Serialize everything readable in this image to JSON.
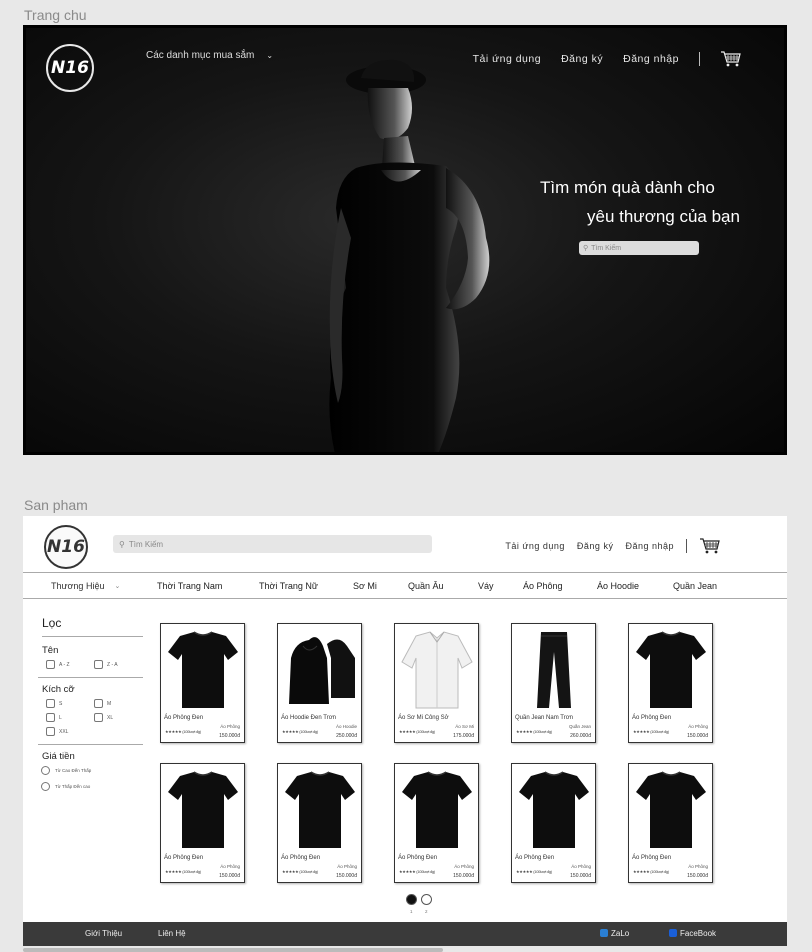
{
  "frames": {
    "home_label": "Trang chu",
    "products_label": "San pham"
  },
  "brand": {
    "logo": "N16"
  },
  "home": {
    "category_menu": "Các danh mục mua sắm",
    "nav": {
      "download": "Tải ứng dụng",
      "register": "Đăng ký",
      "login": "Đăng nhập"
    },
    "hero_line1": "Tìm món quà dành cho",
    "hero_line2": "yêu thương của bạn",
    "search_placeholder": "Tìm Kiếm"
  },
  "products": {
    "search_placeholder": "Tìm Kiếm",
    "nav": {
      "download": "Tải ứng dụng",
      "register": "Đăng ký",
      "login": "Đăng nhập"
    },
    "brand_menu": "Thương Hiệu",
    "categories": [
      "Thời Trang Nam",
      "Thời Trang Nữ",
      "Sơ Mi",
      "Quần Âu",
      "Váy",
      "Áo Phông",
      "Áo Hoodie",
      "Quần Jean"
    ],
    "filter": {
      "title": "Lọc",
      "name_label": "Tên",
      "name_options": [
        "A - Z",
        "Z - A"
      ],
      "size_label": "Kích cỡ",
      "size_options": [
        "S",
        "M",
        "L",
        "XL",
        "XXL"
      ],
      "price_label": "Giá tiền",
      "price_options": [
        "Từ Cao Đến Thấp",
        "Từ Thấp Đến cao"
      ]
    },
    "items": [
      {
        "name": "Áo Phông Đen",
        "type": "Áo Phông",
        "stars": "★★★★★ (100lượt đg)",
        "price": "150.000đ",
        "icon": "tshirt"
      },
      {
        "name": "Áo Hoodie Đen Trơn",
        "type": "Áo Hoodie",
        "stars": "★★★★★ (100lượt đg)",
        "price": "250.000đ",
        "icon": "hoodie"
      },
      {
        "name": "Áo Sơ Mi Công Sở",
        "type": "Áo Sơ Mi",
        "stars": "★★★★★ (100lượt đg)",
        "price": "175.000đ",
        "icon": "shirt"
      },
      {
        "name": "Quần Jean Nam Trơn",
        "type": "Quần Jean",
        "stars": "★★★★★ (100lượt đg)",
        "price": "260.000đ",
        "icon": "jeans"
      },
      {
        "name": "Áo Phông Đen",
        "type": "Áo Phông",
        "stars": "★★★★★ (100lượt đg)",
        "price": "150.000đ",
        "icon": "tshirt"
      },
      {
        "name": "Áo Phông Đen",
        "type": "Áo Phông",
        "stars": "★★★★★ (100lượt đg)",
        "price": "150.000đ",
        "icon": "tshirt"
      },
      {
        "name": "Áo Phông Đen",
        "type": "Áo Phông",
        "stars": "★★★★★ (100lượt đg)",
        "price": "150.000đ",
        "icon": "tshirt"
      },
      {
        "name": "Áo Phông Đen",
        "type": "Áo Phông",
        "stars": "★★★★★ (100lượt đg)",
        "price": "150.000đ",
        "icon": "tshirt"
      },
      {
        "name": "Áo Phông Đen",
        "type": "Áo Phông",
        "stars": "★★★★★ (100lượt đg)",
        "price": "150.000đ",
        "icon": "tshirt"
      },
      {
        "name": "Áo Phông Đen",
        "type": "Áo Phông",
        "stars": "★★★★★ (100lượt đg)",
        "price": "150.000đ",
        "icon": "tshirt"
      }
    ],
    "pagination": [
      "1",
      "2"
    ],
    "footer": {
      "about": "Giới Thiệu",
      "contact": "Liên Hệ",
      "zalo": "ZaLo",
      "facebook": "FaceBook"
    },
    "colors": {
      "zalo": "#2a7fd4",
      "facebook": "#1a5fd8"
    }
  }
}
